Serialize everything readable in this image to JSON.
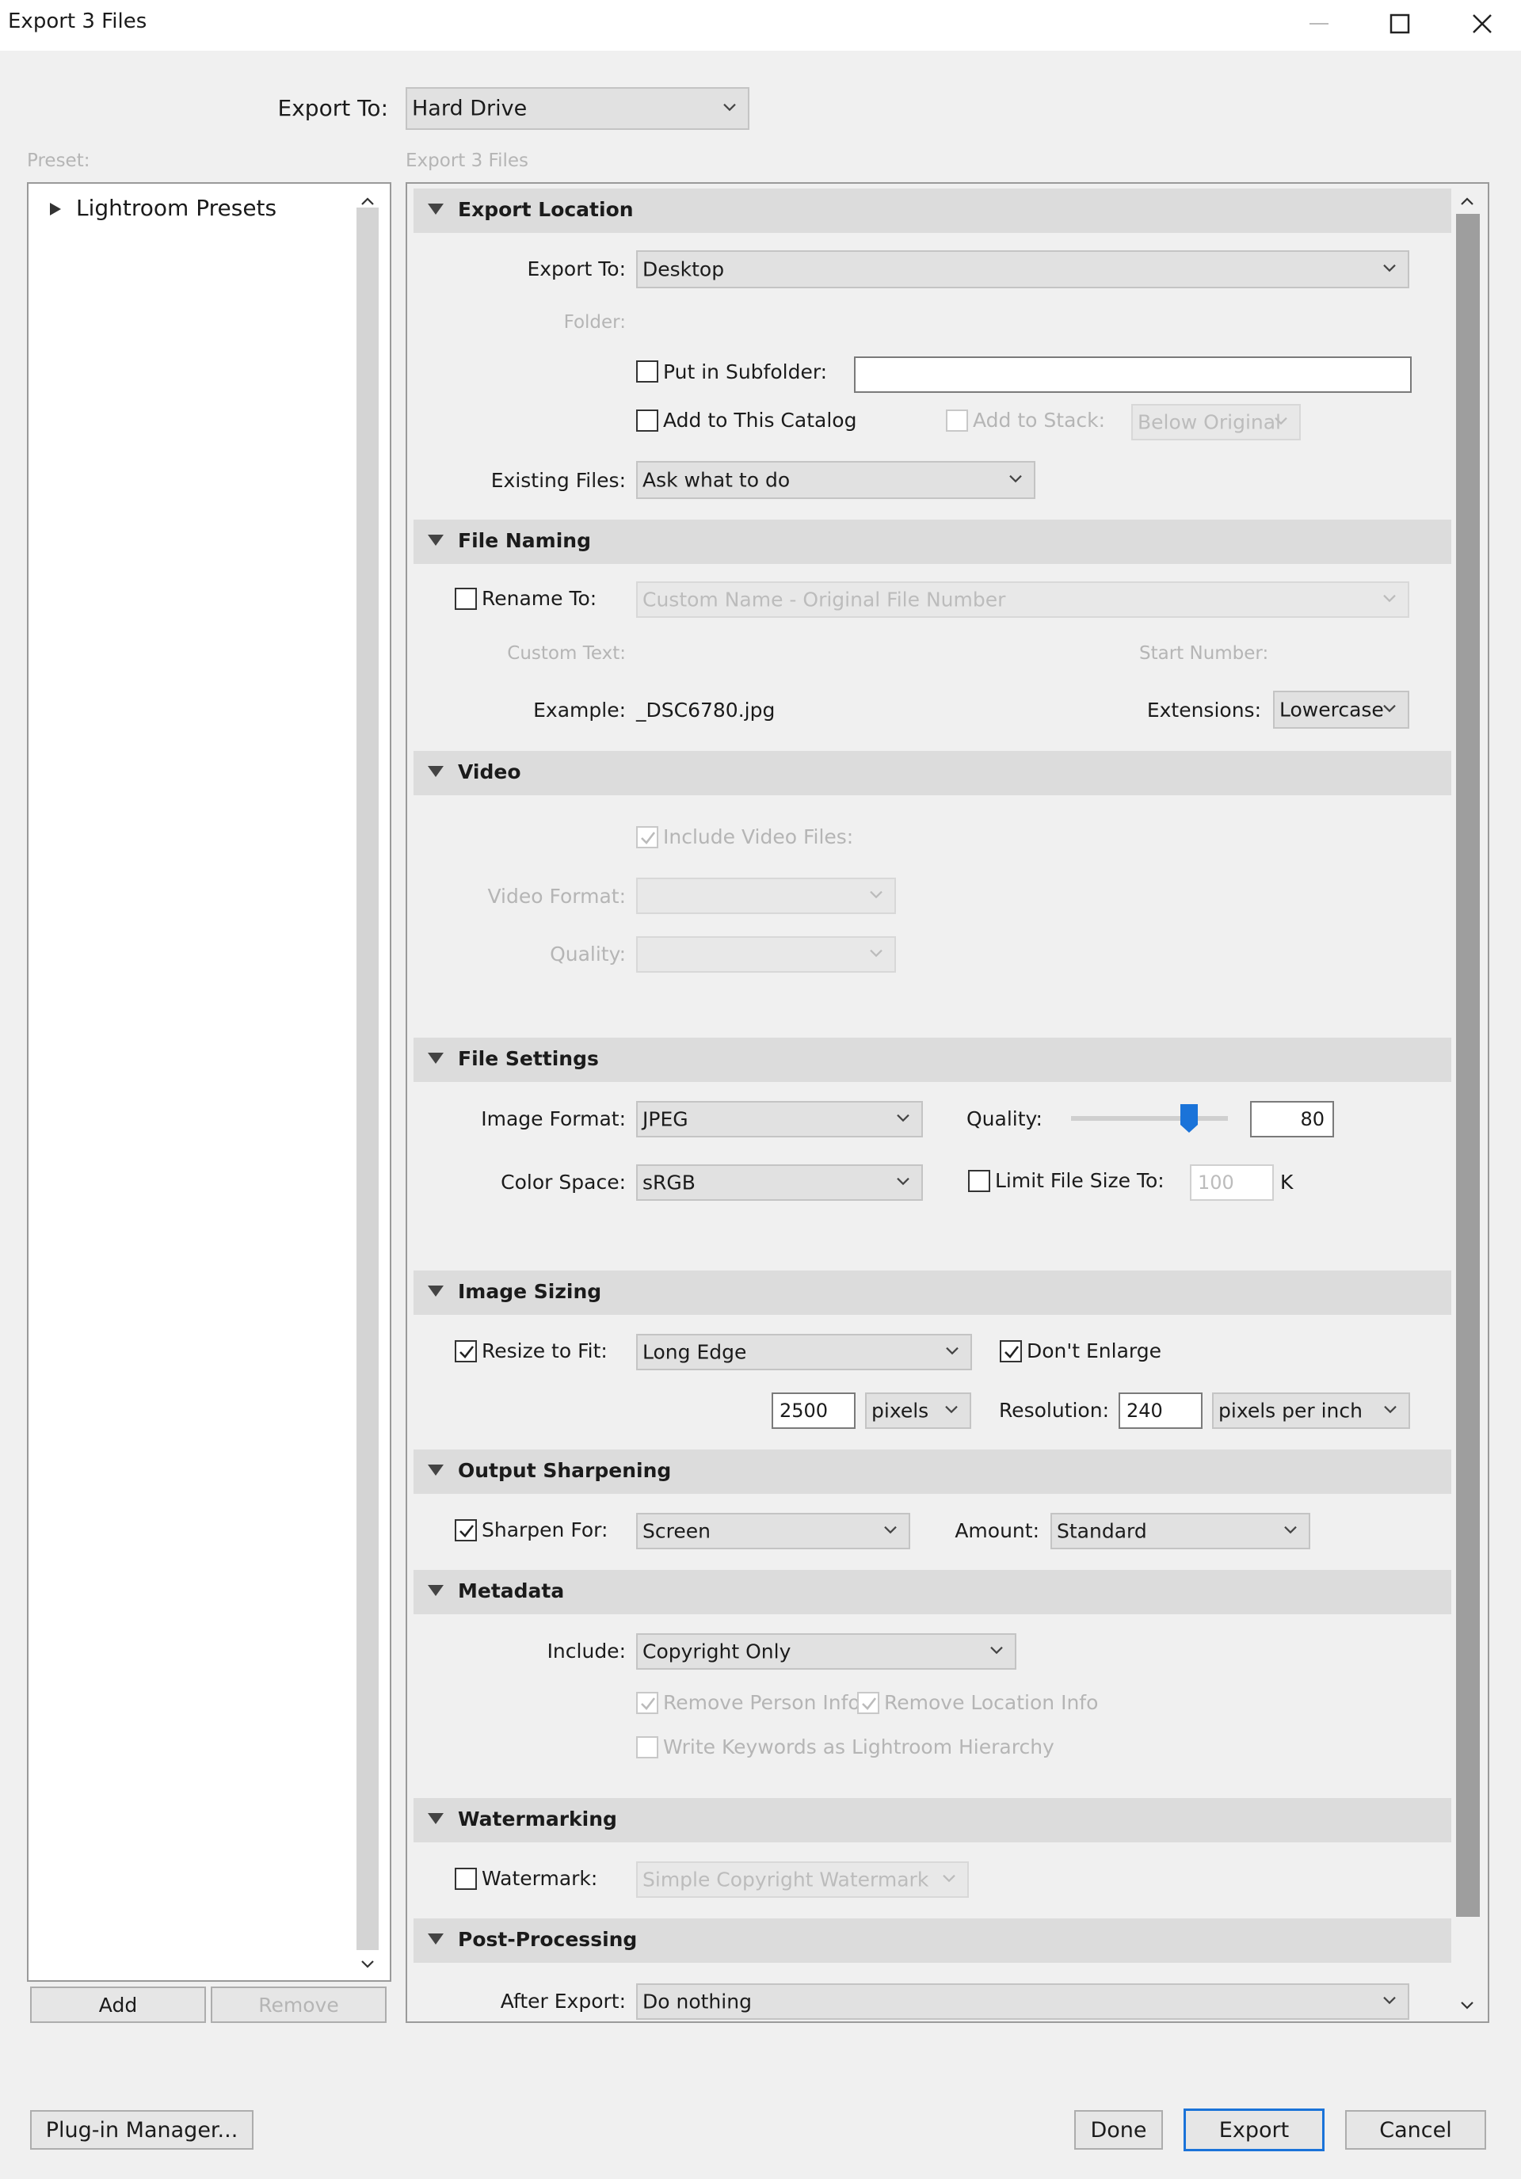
{
  "window": {
    "title": "Export 3 Files"
  },
  "export_to": {
    "label": "Export To:",
    "value": "Hard Drive"
  },
  "preset": {
    "label": "Preset:",
    "tree_item": "Lightroom Presets",
    "add_label": "Add",
    "remove_label": "Remove"
  },
  "main": {
    "label": "Export 3 Files"
  },
  "export_location": {
    "title": "Export Location",
    "export_to_label": "Export To:",
    "export_to_value": "Desktop",
    "folder_label": "Folder:",
    "subfolder_label": "Put in Subfolder:",
    "subfolder_value": "",
    "add_catalog_label": "Add to This Catalog",
    "add_stack_label": "Add to Stack:",
    "stack_value": "Below Original",
    "existing_label": "Existing Files:",
    "existing_value": "Ask what to do"
  },
  "file_naming": {
    "title": "File Naming",
    "rename_label": "Rename To:",
    "rename_value": "Custom Name - Original File Number",
    "custom_text_label": "Custom Text:",
    "start_number_label": "Start Number:",
    "example_label": "Example:",
    "example_value": "_DSC6780.jpg",
    "extensions_label": "Extensions:",
    "extensions_value": "Lowercase"
  },
  "video": {
    "title": "Video",
    "include_label": "Include Video Files:",
    "format_label": "Video Format:",
    "quality_label": "Quality:"
  },
  "file_settings": {
    "title": "File Settings",
    "format_label": "Image Format:",
    "format_value": "JPEG",
    "quality_label": "Quality:",
    "quality_value": "80",
    "colorspace_label": "Color Space:",
    "colorspace_value": "sRGB",
    "limit_label": "Limit File Size To:",
    "limit_value": "100",
    "limit_unit": "K"
  },
  "image_sizing": {
    "title": "Image Sizing",
    "resize_label": "Resize to Fit:",
    "resize_value": "Long Edge",
    "dont_enlarge_label": "Don't Enlarge",
    "size_value": "2500",
    "unit_value": "pixels",
    "resolution_label": "Resolution:",
    "resolution_value": "240",
    "resolution_unit": "pixels per inch"
  },
  "output_sharpening": {
    "title": "Output Sharpening",
    "sharpen_label": "Sharpen For:",
    "sharpen_value": "Screen",
    "amount_label": "Amount:",
    "amount_value": "Standard"
  },
  "metadata": {
    "title": "Metadata",
    "include_label": "Include:",
    "include_value": "Copyright Only",
    "remove_person_label": "Remove Person Info",
    "remove_location_label": "Remove Location Info",
    "keywords_label": "Write Keywords as Lightroom Hierarchy"
  },
  "watermarking": {
    "title": "Watermarking",
    "watermark_label": "Watermark:",
    "watermark_value": "Simple Copyright Watermark"
  },
  "post_processing": {
    "title": "Post-Processing",
    "after_label": "After Export:",
    "after_value": "Do nothing"
  },
  "footer": {
    "plugin_label": "Plug-in Manager...",
    "done_label": "Done",
    "export_label": "Export",
    "cancel_label": "Cancel"
  },
  "accent_color": "#1a73d9"
}
